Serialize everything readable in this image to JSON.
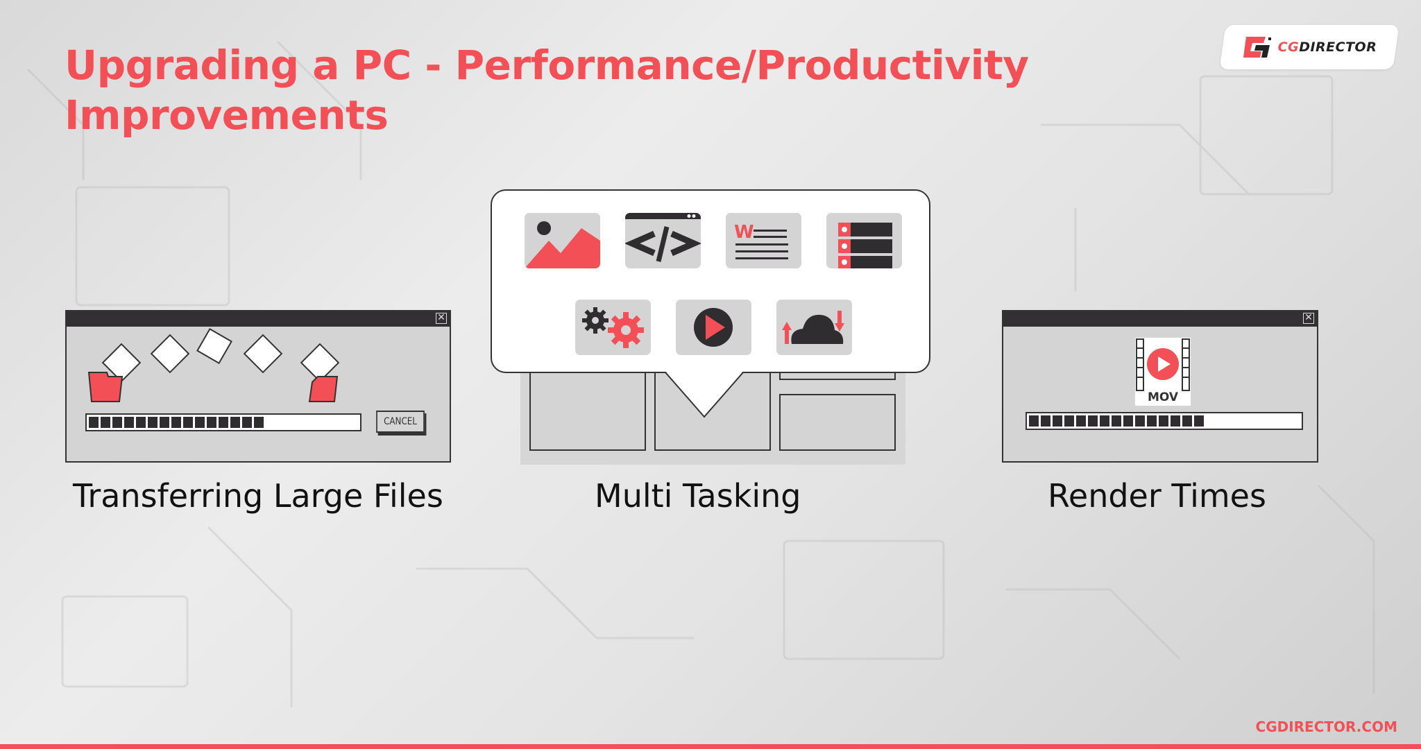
{
  "header": {
    "title_line1": "Upgrading a PC - Performance/Productivity",
    "title_line2": "Improvements"
  },
  "logo": {
    "brand_prefix": "CG",
    "brand_suffix": "DIRECTOR"
  },
  "colors": {
    "accent": "#f25056",
    "dark": "#323032",
    "panel": "#d4d4d4",
    "background": "#e6e6e6"
  },
  "panels": [
    {
      "label": "Transferring Large Files",
      "window": {
        "cancel_label": "CANCEL",
        "progress_segments_filled": 15,
        "progress_fraction": 0.69
      },
      "icons": [
        "folder-icon",
        "document-icon",
        "document-icon",
        "document-icon",
        "document-icon",
        "folder-icon"
      ]
    },
    {
      "label": "Multi Tasking",
      "icons": [
        "image-icon",
        "code-icon",
        "word-document-icon",
        "server-icon",
        "gears-icon",
        "play-icon",
        "cloud-sync-icon"
      ]
    },
    {
      "label": "Render Times",
      "window": {
        "file_label": "MOV",
        "progress_segments_filled": 15,
        "progress_fraction": 0.68
      },
      "icons": [
        "movie-file-icon"
      ]
    }
  ],
  "footer": {
    "url": "CGDIRECTOR.COM"
  }
}
